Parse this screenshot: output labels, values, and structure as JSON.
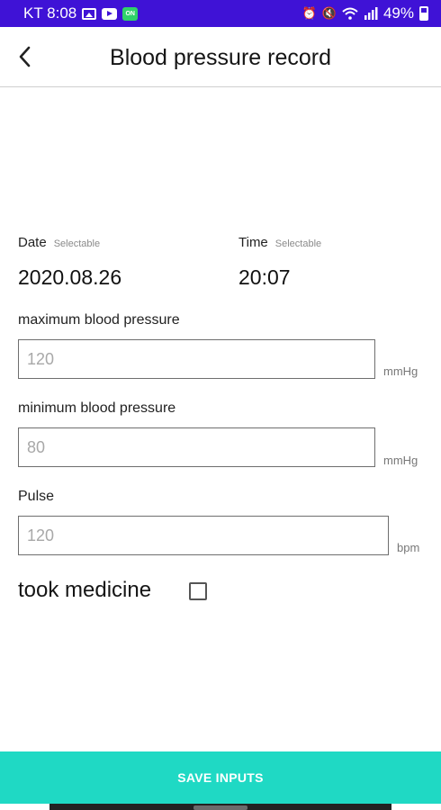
{
  "status_bar": {
    "carrier_time": "KT 8:08",
    "battery": "49%",
    "chat_badge": "ON",
    "icons": [
      "image-icon",
      "youtube-icon",
      "chat-icon",
      "alarm-icon",
      "mute-icon",
      "wifi-icon",
      "signal-icon",
      "battery-icon"
    ]
  },
  "header": {
    "title": "Blood pressure record"
  },
  "date": {
    "label": "Date",
    "hint": "Selectable",
    "value": "2020.08.26"
  },
  "time": {
    "label": "Time",
    "hint": "Selectable",
    "value": "20:07"
  },
  "max_bp": {
    "label": "maximum blood pressure",
    "placeholder": "120",
    "unit": "mmHg"
  },
  "min_bp": {
    "label": "minimum blood pressure",
    "placeholder": "80",
    "unit": "mmHg"
  },
  "pulse": {
    "label": "Pulse",
    "placeholder": "120",
    "unit": "bpm"
  },
  "medicine": {
    "label": "took medicine",
    "checked": false
  },
  "actions": {
    "save_label": "SAVE INPUTS"
  },
  "colors": {
    "status_bar": "#3f12d6",
    "save_button": "#1fd9c4"
  }
}
